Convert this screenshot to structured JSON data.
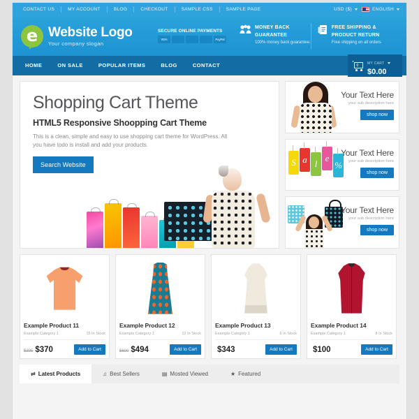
{
  "topbar": {
    "links": [
      "CONTACT US",
      "MY ACCOUNT",
      "BLOG",
      "CHECKOUT",
      "SAMPLE CSS",
      "SAMPLE PAGE"
    ],
    "currency": "USD ($)",
    "language": "ENGLISH"
  },
  "header": {
    "logo_letter": "e",
    "logo_name": "Website Logo",
    "logo_slogan": "Your company slogan",
    "secure": {
      "title": "SECURE ONLINE PAYMENTS",
      "cards": [
        "VISA",
        "MC",
        "CARD",
        "CARD",
        "PayPal"
      ]
    },
    "features": [
      {
        "icon": "people-icon",
        "title_line1": "MONEY BACK",
        "title_line2": "GUARANTEE",
        "subtitle": "100% money back guarantee."
      },
      {
        "icon": "box-icon",
        "title_line1": "FREE SHIPPING &",
        "title_line2": "PRODUCT RETURN",
        "subtitle": "Free shipping on all orders"
      }
    ]
  },
  "nav": {
    "items": [
      "HOME",
      "ON SALE",
      "POPULAR ITEMS",
      "BLOG",
      "CONTACT"
    ],
    "cart": {
      "count": "0",
      "label": "MY CART",
      "total": "$0.00"
    }
  },
  "hero": {
    "title": "Shopping Cart Theme",
    "subtitle": "HTML5 Responsive Shoopping Cart Theme",
    "description": "This is a clean, simple and easy to use shopping cart theme for WordPress. All you have todo is install and add your products.",
    "button": "Search Website"
  },
  "banners": [
    {
      "title": "Your Text Here",
      "subtitle": "your sub description here",
      "button": "shop now"
    },
    {
      "title": "Your Text Here",
      "subtitle": "your sub description here",
      "button": "shop now"
    },
    {
      "title": "Your Text Here",
      "subtitle": "your sub description here",
      "button": "shop now"
    }
  ],
  "products": [
    {
      "name": "Example Product 11",
      "category": "Example Category 1",
      "stock": "15 In Stock",
      "old_price": "$395",
      "price": "$370",
      "button": "Add to Cart"
    },
    {
      "name": "Example Product 12",
      "category": "Example Category 1",
      "stock": "12 In Stock",
      "old_price": "$600",
      "price": "$494",
      "button": "Add to Cart"
    },
    {
      "name": "Example Product 13",
      "category": "Example Category 1",
      "stock": "6 In Stock",
      "old_price": "",
      "price": "$343",
      "button": "Add to Cart"
    },
    {
      "name": "Example Product 14",
      "category": "Example Category 1",
      "stock": "8 In Stock",
      "old_price": "",
      "price": "$100",
      "button": "Add to Cart"
    }
  ],
  "tabs": [
    {
      "icon": "⇄",
      "label": "Latest Products",
      "active": true
    },
    {
      "icon": "♫",
      "label": "Best Sellers",
      "active": false
    },
    {
      "icon": "▤",
      "label": "Mosted Viewed",
      "active": false
    },
    {
      "icon": "★",
      "label": "Featured",
      "active": false
    }
  ],
  "colors": {
    "topbar": "#2fa3dd",
    "header": "#1d93d2",
    "nav": "#126da5",
    "accent": "#1479bf",
    "cart": "#0d5f93",
    "logo_mark": "#8cc63f"
  }
}
